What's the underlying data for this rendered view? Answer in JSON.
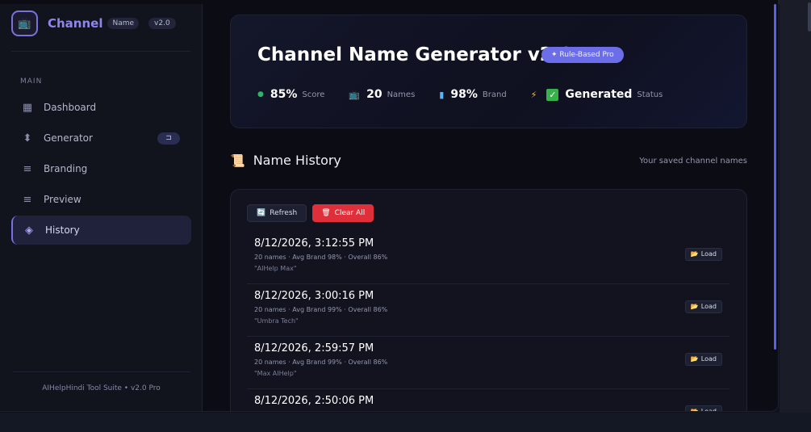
{
  "sidebar": {
    "brand_title": "Channel",
    "brand_badge": "Name",
    "version": "v2.0",
    "logo_icon": "tv-icon",
    "section": "MAIN",
    "items": [
      {
        "label": "Dashboard",
        "icon": "grid-icon",
        "glyph": "▦"
      },
      {
        "label": "Generator",
        "icon": "diamond-icon",
        "glyph": "⬍",
        "pill": "⊐"
      },
      {
        "label": "Branding",
        "icon": "lines-icon",
        "glyph": "≡"
      },
      {
        "label": "Preview",
        "icon": "lines-icon",
        "glyph": "≡"
      },
      {
        "label": "History",
        "icon": "layers-icon",
        "glyph": "◈",
        "active": true
      }
    ],
    "footer": "AIHelpHindi Tool Suite • v2.0 Pro"
  },
  "hero": {
    "title": "Channel Name Generator v2.0",
    "badge": "✦ Rule-Based Pro",
    "stats": [
      {
        "icon": "green-dot-icon",
        "value": "85%",
        "label": "Score"
      },
      {
        "icon": "tv-icon",
        "value": "20",
        "label": "Names"
      },
      {
        "icon": "bar-chart-icon",
        "value": "98%",
        "label": "Brand"
      },
      {
        "icon": "lightning-icon",
        "value": "Generated",
        "label": "Status"
      }
    ]
  },
  "history": {
    "title": "Name History",
    "subtitle": "Your saved channel names",
    "refresh_label": "Refresh",
    "clear_label": "Clear All",
    "load_label": "Load",
    "rows": [
      {
        "date": "8/12/2026, 3:12:55 PM",
        "meta": "20 names · Avg Brand 98% · Overall 86%",
        "name": "\"AIHelp Max\""
      },
      {
        "date": "8/12/2026, 3:00:16 PM",
        "meta": "20 names · Avg Brand 99% · Overall 86%",
        "name": "\"Umbra Tech\""
      },
      {
        "date": "8/12/2026, 2:59:57 PM",
        "meta": "20 names · Avg Brand 99% · Overall 86%",
        "name": "\"Max AIHelp\""
      },
      {
        "date": "8/12/2026, 2:50:06 PM",
        "meta": "",
        "name": ""
      }
    ]
  },
  "colors": {
    "accent": "#7a70e6",
    "danger": "#de2f3a",
    "success": "#35b34a",
    "badge": "#6c6ee8"
  }
}
